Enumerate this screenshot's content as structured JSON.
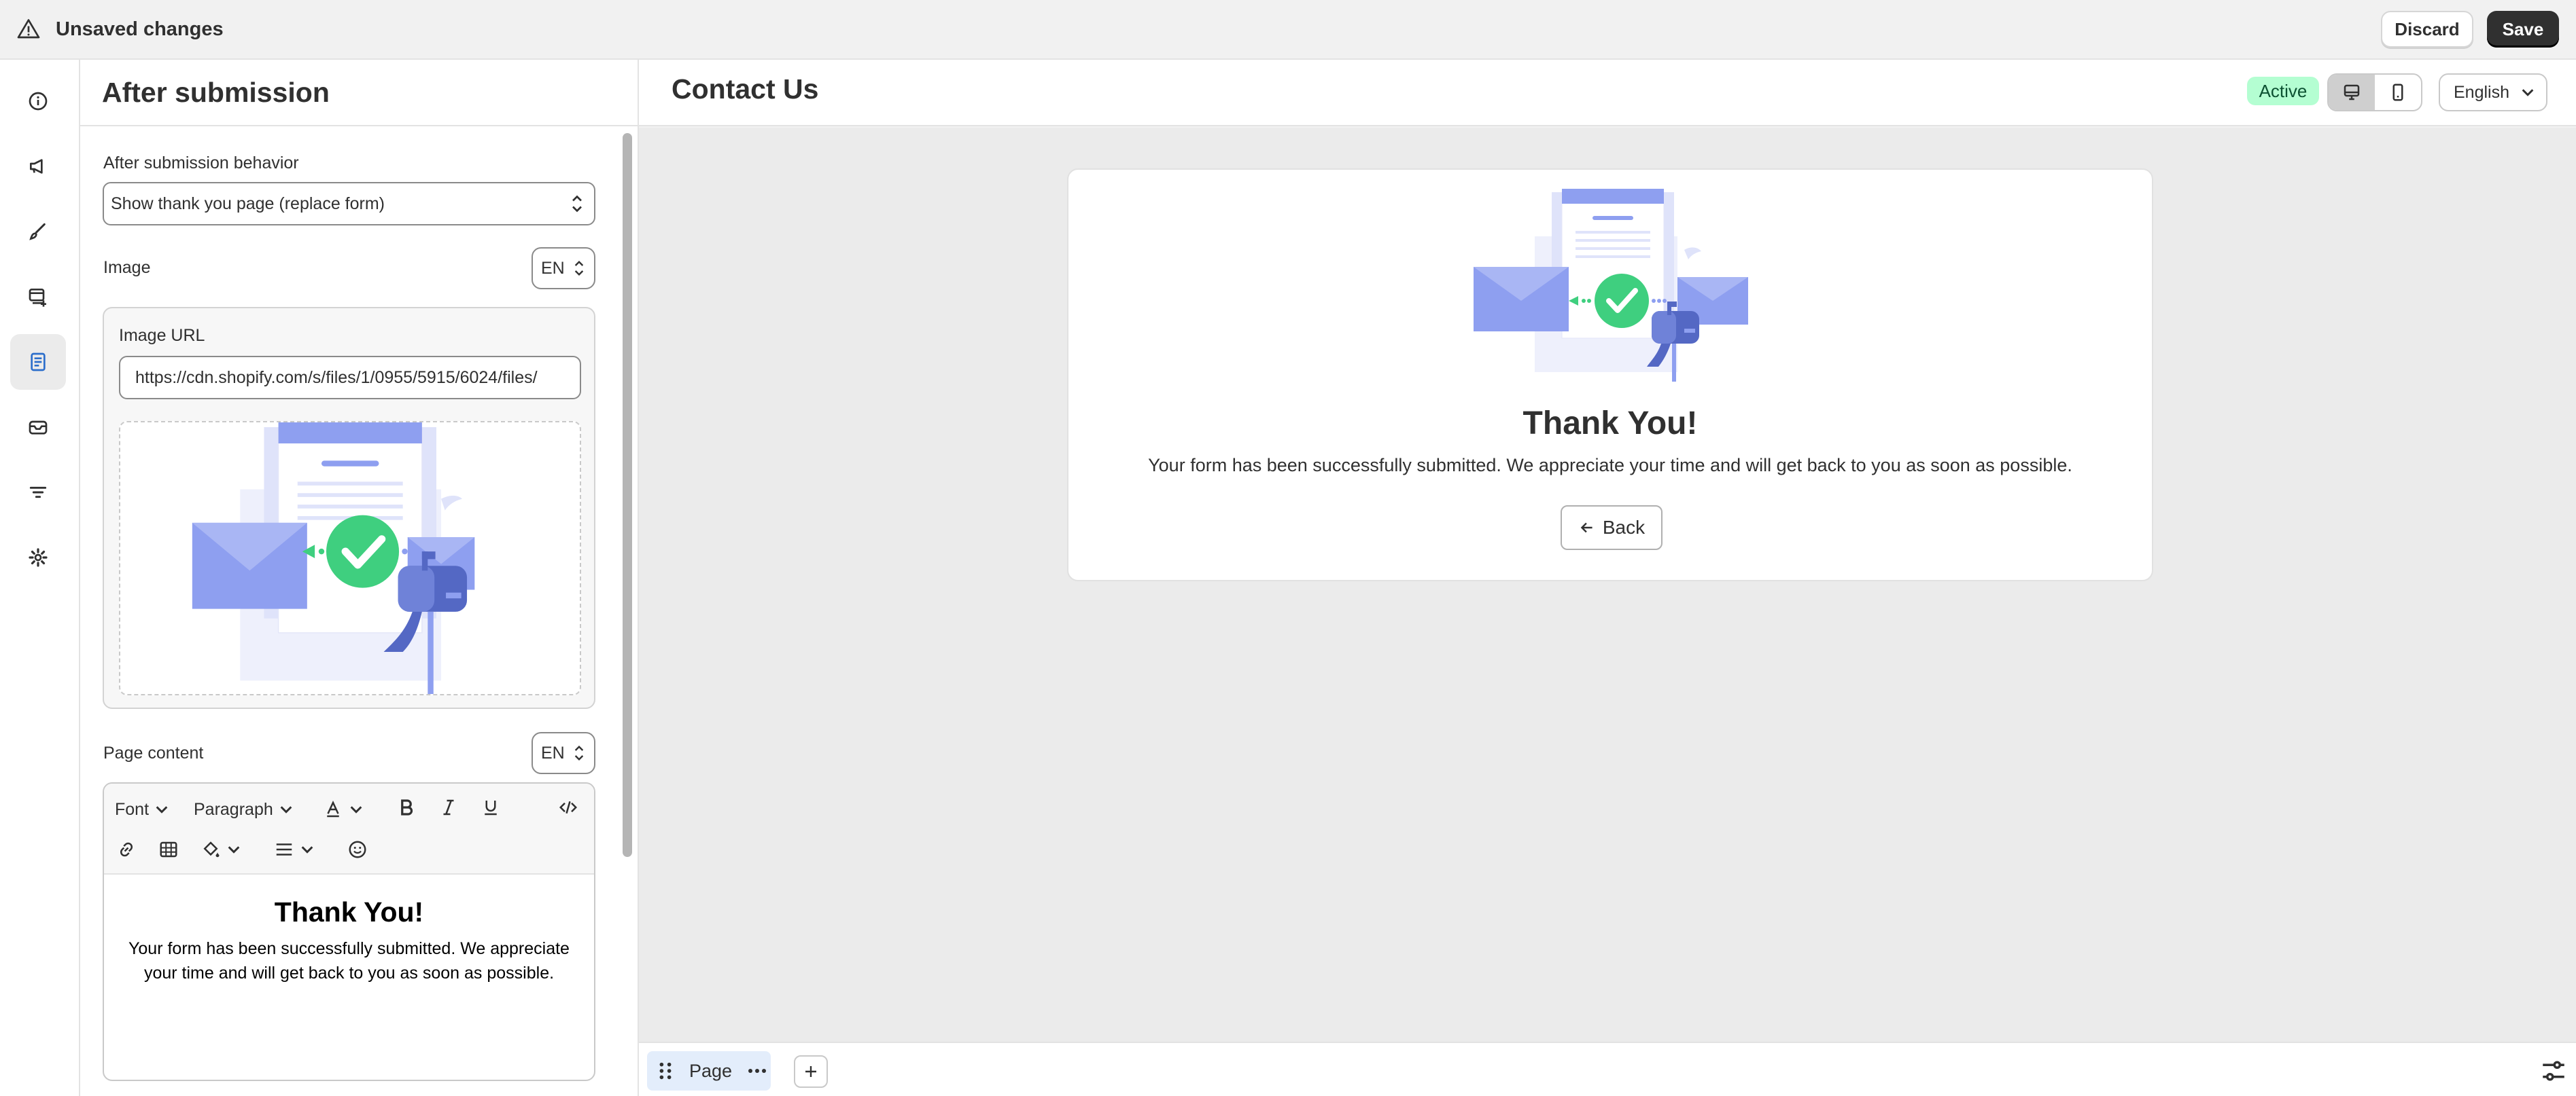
{
  "topbar": {
    "status": "Unsaved changes",
    "discard_label": "Discard",
    "save_label": "Save"
  },
  "rail": {
    "items": [
      {
        "icon": "info-icon"
      },
      {
        "icon": "megaphone-icon"
      },
      {
        "icon": "paint-brush-icon"
      },
      {
        "icon": "form-fields-icon"
      },
      {
        "icon": "after-submission-icon",
        "active": true
      },
      {
        "icon": "email-icon"
      },
      {
        "icon": "filter-icon"
      },
      {
        "icon": "gear-icon"
      }
    ]
  },
  "panel": {
    "title": "After submission",
    "behavior_label": "After submission behavior",
    "behavior_value": "Show thank you page (replace form)",
    "image_label": "Image",
    "image_lang": "EN",
    "image_url_label": "Image URL",
    "image_url_value": "https://cdn.shopify.com/s/files/1/0955/5915/6024/files/",
    "content_label": "Page content",
    "content_lang": "EN",
    "toolbar": {
      "font_label": "Font",
      "paragraph_label": "Paragraph"
    },
    "content_heading": "Thank You!",
    "content_body": "Your form has been successfully submitted. We appreciate your time and will get back to you as soon as possible."
  },
  "main": {
    "title": "Contact Us",
    "status_badge": "Active",
    "language": "English",
    "card": {
      "heading": "Thank You!",
      "body": "Your form has been successfully submitted. We appreciate your time and will get back to you as soon as possible.",
      "back_label": "Back"
    }
  },
  "bottombar": {
    "page_tab_label": "Page"
  },
  "colors": {
    "accent_dark": "#303030",
    "active_badge_bg": "#b4fed2",
    "illustration_blue": "#8e9ff0",
    "illustration_green": "#3fcf7f"
  }
}
